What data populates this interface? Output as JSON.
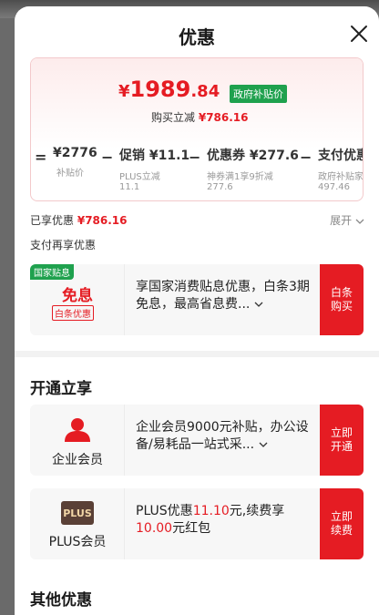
{
  "sheet": {
    "title": "优惠"
  },
  "price": {
    "currency": "¥",
    "integer": "1989",
    "decimal": ".84",
    "badge": "政府补贴价",
    "instant_label": "购买立减",
    "instant_amount": "¥786.16"
  },
  "breakdown": [
    {
      "op": "=",
      "main": "¥2776",
      "sub1": "补贴价",
      "sub2": ""
    },
    {
      "op": "−",
      "main": "促销 ¥11.1",
      "sub1": "PLUS立减",
      "sub2": "11.1"
    },
    {
      "op": "−",
      "main": "优惠券 ¥277.6",
      "sub1": "神券满1享9折减",
      "sub2": "277.6"
    },
    {
      "op": "−",
      "main": "支付优惠",
      "sub1": "政府补贴家",
      "sub2": "497.46"
    }
  ],
  "summary": {
    "enjoyed_label": "已享优惠",
    "enjoyed_amount": "¥786.16",
    "expand_label": "展开",
    "pay_more_label": "支付再享优惠"
  },
  "interest_offer": {
    "tag": "国家贴息",
    "title": "免息",
    "subtag": "白条优惠",
    "text": "享国家消费贴息优惠，白条3期免息，最高省息费...",
    "button": "白条购买"
  },
  "open_section": {
    "title": "开通立享",
    "enterprise": {
      "label": "企业会员",
      "text": "企业会员9000元补贴，办公设备/易耗品一站式采...",
      "button": "立即开通"
    },
    "plus": {
      "logo": "PLUS",
      "label": "PLUS会员",
      "text_pre": "PLUS优惠",
      "text_hl1": "11.10",
      "text_mid": "元,续费享",
      "text_hl2": "10.00",
      "text_post": "元红包",
      "button": "立即续费"
    }
  },
  "other_section": {
    "title": "其他优惠"
  },
  "colors": {
    "accent": "#e51c23",
    "green": "#1fa14e"
  },
  "icons": [
    "close-icon",
    "chevron-down-icon",
    "enterprise-user-icon",
    "plus-logo-icon"
  ]
}
